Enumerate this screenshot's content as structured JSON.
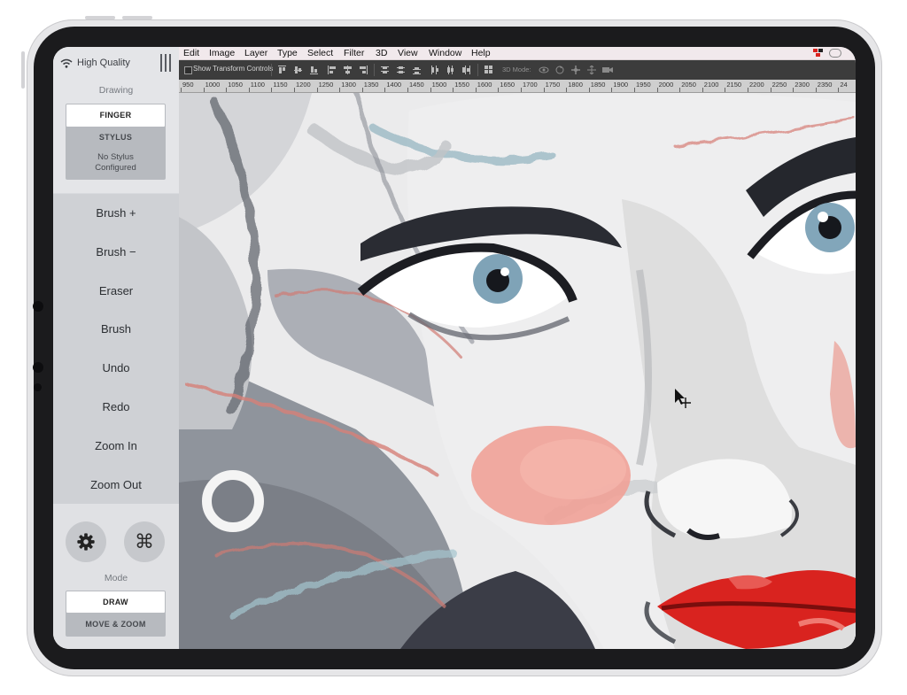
{
  "sidebar": {
    "quality_label": "High Quality",
    "drawing_section_label": "Drawing",
    "drawing_modes": [
      "FINGER",
      "STYLUS"
    ],
    "stylus_status": "No Stylus Configured",
    "buttons": [
      "Brush +",
      "Brush −",
      "Eraser",
      "Brush",
      "Undo",
      "Redo",
      "Zoom In",
      "Zoom Out"
    ],
    "mode_section_label": "Mode",
    "modes": [
      "DRAW",
      "MOVE & ZOOM"
    ]
  },
  "menubar": {
    "items": [
      "Edit",
      "Image",
      "Layer",
      "Type",
      "Select",
      "Filter",
      "3D",
      "View",
      "Window",
      "Help"
    ]
  },
  "toolbar": {
    "transform_controls_label": "Show Transform Controls",
    "mode_3d_label": "3D Mode:"
  },
  "ruler": {
    "ticks": [
      "950",
      "1000",
      "1050",
      "1100",
      "1150",
      "1200",
      "1250",
      "1300",
      "1350",
      "1400",
      "1450",
      "1500",
      "1550",
      "1600",
      "1650",
      "1700",
      "1750",
      "1800",
      "1850",
      "1900",
      "1950",
      "2000",
      "2050",
      "2100",
      "2150",
      "2200",
      "2250",
      "2300",
      "2350",
      "24"
    ]
  },
  "colors": {
    "sidebar_bg": "#d9dbdf",
    "toolbar_bg": "#3c3c3c",
    "menubar_bg": "#f1e9ec",
    "lips_red": "#d9231f",
    "cheek_pink": "#f0a197"
  }
}
